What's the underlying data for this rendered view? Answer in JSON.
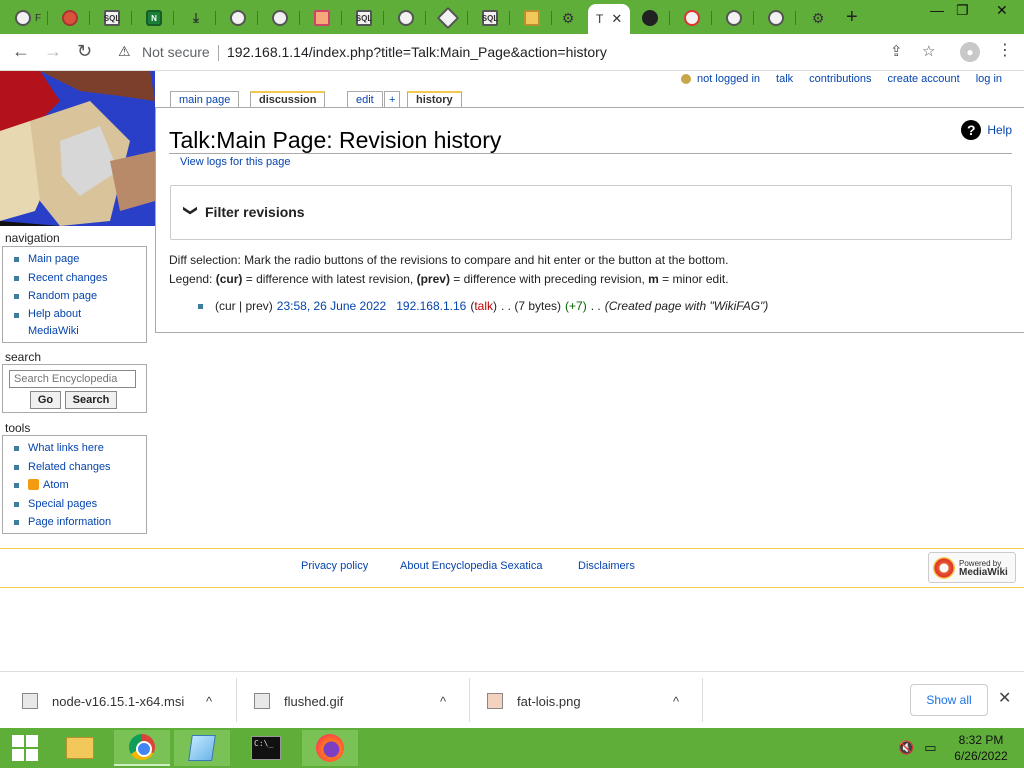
{
  "browser": {
    "tabs": [
      {
        "label": "F",
        "icon": "globe-icon"
      },
      {
        "label": "",
        "icon": "app-icon"
      },
      {
        "label": "",
        "icon": "sqlite-icon"
      },
      {
        "label": "",
        "icon": "node-icon"
      },
      {
        "label": "",
        "icon": "download-icon"
      },
      {
        "label": "",
        "icon": "globe-icon"
      },
      {
        "label": "",
        "icon": "globe-icon"
      },
      {
        "label": "",
        "icon": "app-icon"
      },
      {
        "label": "",
        "icon": "sqlite-icon"
      },
      {
        "label": "",
        "icon": "chrome-icon"
      },
      {
        "label": "",
        "icon": "diamond-icon"
      },
      {
        "label": "",
        "icon": "sqlite-icon"
      },
      {
        "label": "",
        "icon": "file-icon"
      },
      {
        "label": "",
        "icon": "gear-icon"
      }
    ],
    "active_tab": {
      "label": "T",
      "close": "✕"
    },
    "tabs_right": [
      {
        "label": "",
        "icon": "face-icon"
      },
      {
        "label": "",
        "icon": "opera-icon"
      },
      {
        "label": "",
        "icon": "globe-icon"
      },
      {
        "label": "",
        "icon": "globe-icon"
      },
      {
        "label": "",
        "icon": "gear-icon"
      }
    ],
    "new_tab": "+",
    "window_controls": {
      "minimize": "—",
      "maximize": "❐",
      "close": "✕"
    },
    "nav": {
      "back": "←",
      "forward": "→",
      "reload": "↻"
    },
    "security_icon": "⚠",
    "security_label": "Not secure",
    "url": "192.168.1.14/index.php?title=Talk:Main_Page&action=history",
    "share_icon": "⇪",
    "bookmark_icon": "☆",
    "profile_icon": "●",
    "menu_icon": "⋮"
  },
  "wiki": {
    "personal": {
      "not_logged_in": "not logged in",
      "talk": "talk",
      "contributions": "contributions",
      "create_account": "create account",
      "log_in": "log in"
    },
    "tabs": {
      "main_page": "main page",
      "discussion": "discussion",
      "edit": "edit",
      "plus": "+",
      "history": "history"
    },
    "heading": "Talk:Main Page: Revision history",
    "help": "Help",
    "help_glyph": "?",
    "view_logs": "View logs for this page",
    "filter_chevron": "❯",
    "filter_title": "Filter revisions",
    "diff_selection": "Diff selection: Mark the radio buttons of the revisions to compare and hit enter or the button at the bottom.",
    "legend": {
      "prefix": "Legend: ",
      "cur": "(cur)",
      "cur_desc": " = difference with latest revision, ",
      "prev": "(prev)",
      "prev_desc": " = difference with preceding revision, ",
      "m": "m",
      "m_desc": " = minor edit."
    },
    "revision": {
      "cur_prev": "(cur | prev)",
      "date": "23:58, 26 June 2022",
      "user": "192.168.1.16",
      "talk_open": "(",
      "talk": "talk",
      "talk_close": ")",
      "size": ". . (7 bytes)",
      "diff": "(+7)",
      "sep": ". .",
      "comment": "(Created page with \"WikiFAG\")"
    },
    "sidebar": {
      "navigation_heading": "navigation",
      "navigation": [
        "Main page",
        "Recent changes",
        "Random page",
        "Help about MediaWiki"
      ],
      "search_heading": "search",
      "search_placeholder": "Search Encyclopedia",
      "go": "Go",
      "search": "Search",
      "tools_heading": "tools",
      "tools": [
        "What links here",
        "Related changes",
        "Atom",
        "Special pages",
        "Page information"
      ]
    },
    "footer": {
      "privacy": "Privacy policy",
      "about": "About Encyclopedia Sexatica",
      "disclaimers": "Disclaimers",
      "powered_by": "Powered by",
      "mediawiki": "MediaWiki"
    }
  },
  "downloads": {
    "items": [
      {
        "name": "node-v16.15.1-x64.msi"
      },
      {
        "name": "flushed.gif"
      },
      {
        "name": "fat-lois.png"
      }
    ],
    "chevron": "^",
    "show_all": "Show all",
    "close": "✕"
  },
  "taskbar": {
    "cmd_text": "C:\\_",
    "tray": {
      "volume": "🔇",
      "network": "▭"
    },
    "time": "8:32 PM",
    "date": "6/26/2022"
  },
  "colors": {
    "accent_green": "#5fae3a",
    "link": "#0645ad",
    "red_link": "#ba0000",
    "positive": "#006400",
    "tab_highlight": "#f2c94c"
  }
}
